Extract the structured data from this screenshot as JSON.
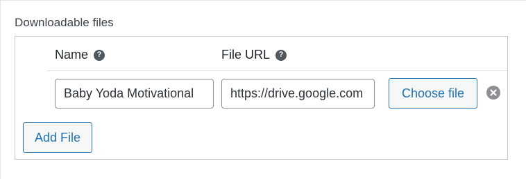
{
  "section": {
    "label": "Downloadable files"
  },
  "table": {
    "columns": [
      {
        "label": "Name",
        "help_icon": "question-circle-icon"
      },
      {
        "label": "File URL",
        "help_icon": "question-circle-icon"
      }
    ],
    "rows": [
      {
        "name_value": "Baby Yoda Motivational",
        "url_value": "https://drive.google.com",
        "choose_label": "Choose file",
        "remove_icon": "remove-circle-icon"
      }
    ]
  },
  "actions": {
    "add_label": "Add File"
  },
  "colors": {
    "accent": "#2271b1",
    "border": "#c3c4c7",
    "icon_gray": "#8c8f94"
  }
}
